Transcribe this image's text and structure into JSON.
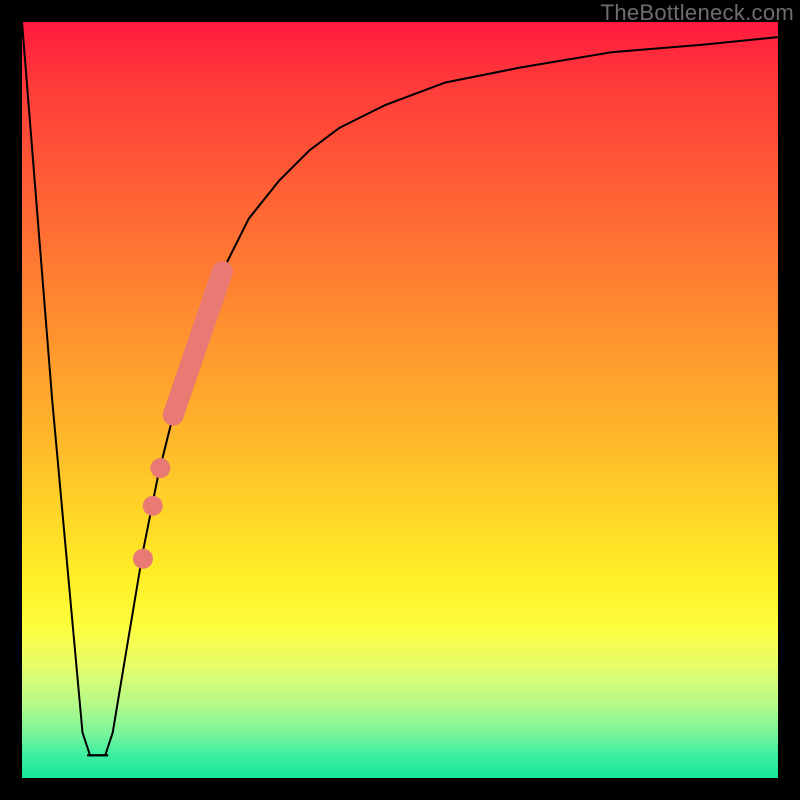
{
  "attribution": "TheBottleneck.com",
  "colors": {
    "accent_marker": "#e97a73",
    "curve": "#000000",
    "frame": "#000000"
  },
  "chart_data": {
    "type": "line",
    "title": "",
    "xlabel": "",
    "ylabel": "",
    "xlim": [
      0,
      100
    ],
    "ylim": [
      0,
      100
    ],
    "grid": false,
    "legend": false,
    "series": [
      {
        "name": "bottleneck-curve",
        "x": [
          0,
          4,
          8,
          9,
          10,
          11,
          12,
          14,
          16,
          18,
          20,
          22,
          24,
          26,
          28,
          30,
          34,
          38,
          42,
          48,
          56,
          66,
          78,
          90,
          100
        ],
        "y": [
          100,
          50,
          6,
          3,
          3,
          3,
          6,
          18,
          30,
          40,
          48,
          55,
          61,
          66,
          70,
          74,
          79,
          83,
          86,
          89,
          92,
          94,
          96,
          97,
          98
        ]
      }
    ],
    "markers": {
      "bar_segment": {
        "x_start": 20.0,
        "y_start": 48,
        "x_end": 26.5,
        "y_end": 67
      },
      "dots": [
        {
          "x": 18.3,
          "y": 41
        },
        {
          "x": 17.3,
          "y": 36
        },
        {
          "x": 16.0,
          "y": 29
        }
      ]
    },
    "background_gradient": {
      "type": "vertical",
      "stops": [
        {
          "pos": 0.0,
          "color": "#ff1a3e"
        },
        {
          "pos": 0.5,
          "color": "#ffba2a"
        },
        {
          "pos": 0.8,
          "color": "#fdfd3e"
        },
        {
          "pos": 1.0,
          "color": "#18e89a"
        }
      ]
    }
  }
}
